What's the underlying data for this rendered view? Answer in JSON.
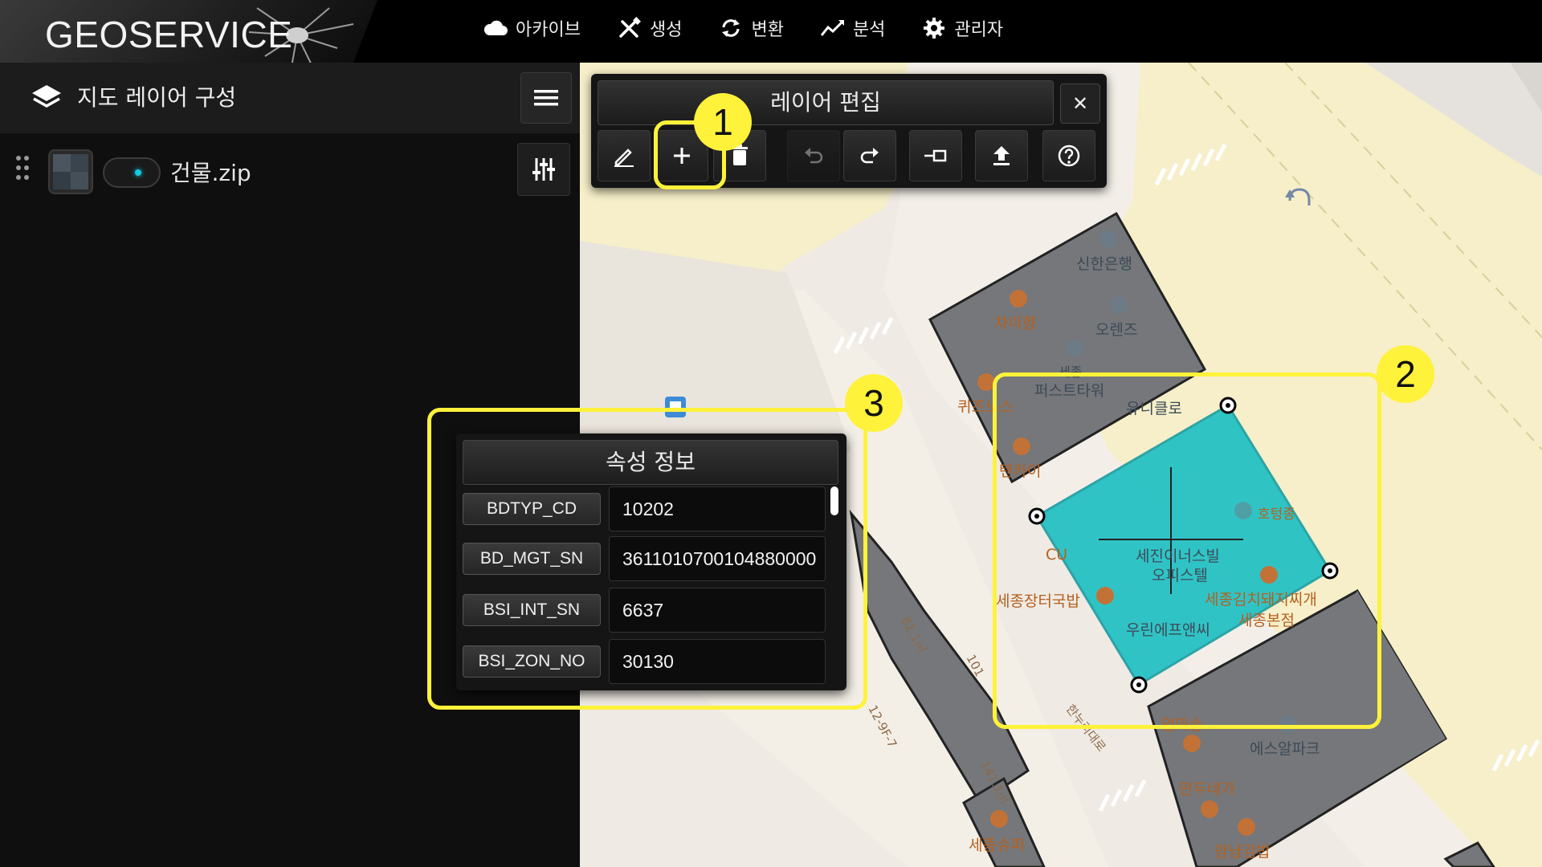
{
  "app": {
    "logo": "GEOSERVICE"
  },
  "nav": [
    {
      "label": "아카이브",
      "icon": "cloud-icon"
    },
    {
      "label": "생성",
      "icon": "tools-icon"
    },
    {
      "label": "변환",
      "icon": "sync-icon"
    },
    {
      "label": "분석",
      "icon": "chart-line-icon"
    },
    {
      "label": "관리자",
      "icon": "gear-icon"
    }
  ],
  "sidebar": {
    "title": "지도 레이어 구성",
    "layers": [
      {
        "name": "건물.zip",
        "visible": true
      }
    ]
  },
  "edit_toolbar": {
    "title": "레이어 편집",
    "close_label": "✕",
    "buttons": [
      {
        "name": "edit-button",
        "icon": "pencil-icon",
        "enabled": true
      },
      {
        "name": "add-feature-button",
        "icon": "plus-icon",
        "enabled": true
      },
      {
        "name": "delete-button",
        "icon": "trash-icon",
        "enabled": true
      },
      {
        "name": "undo-button",
        "icon": "undo-icon",
        "enabled": false
      },
      {
        "name": "redo-button",
        "icon": "redo-icon",
        "enabled": true
      },
      {
        "name": "split-button",
        "icon": "split-icon",
        "enabled": true
      },
      {
        "name": "upload-button",
        "icon": "upload-icon",
        "enabled": true
      },
      {
        "name": "help-button",
        "icon": "help-icon",
        "enabled": true
      }
    ]
  },
  "attribute_panel": {
    "title": "속성 정보",
    "rows": [
      {
        "key": "BDTYP_CD",
        "value": "10202"
      },
      {
        "key": "BD_MGT_SN",
        "value": "3611010700104880000"
      },
      {
        "key": "BSI_INT_SN",
        "value": "6637"
      },
      {
        "key": "BSI_ZON_NO",
        "value": "30130"
      }
    ]
  },
  "map": {
    "labels": {
      "shinhan": "신한은행",
      "chaiyang": "차이향",
      "orange": "오렌즈",
      "sejong": "세종",
      "first_tower": "퍼스트타워",
      "uniqlo": "유니클로",
      "ququs": "퀴즈노스",
      "tenkai": "텐카이",
      "hotpot": "호텅종",
      "cu": "CU",
      "sejin": "세진이너스빌",
      "officetel": "오피스텔",
      "jangteo": "세종장터국밥",
      "kimchi": "세종김치돼지찌개",
      "kimchi2": "세종본점",
      "woori": "우린에프앤씨",
      "eomma": "엄마손",
      "s_alpark": "에스알파크",
      "mandu": "만두네가",
      "amnyeon": "암냠김밥",
      "sejong_super": "세종슈퍼",
      "area1": "82.1㎡",
      "num101": "101",
      "num129": "12-9F-7",
      "area2": "141.1㎡",
      "road": "한누리대로"
    }
  },
  "annotations": [
    "1",
    "2",
    "3"
  ],
  "colors": {
    "accent": "#11c9e0",
    "highlight": "#fff23a",
    "polygon_fill": "#20c0c4",
    "building": "#75777a"
  }
}
